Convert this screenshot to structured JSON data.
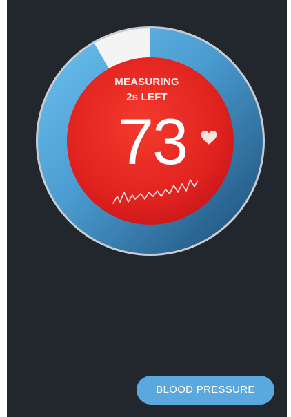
{
  "measurement": {
    "status_label": "MEASURING",
    "time_left_label": "2s LEFT",
    "heart_rate_value": "73",
    "progress_fraction": 0.917
  },
  "actions": {
    "blood_pressure_label": "BLOOD PRESSURE"
  },
  "icons": {
    "heart": "heart-icon",
    "pulse_wave": "pulse-wave-icon"
  },
  "colors": {
    "background": "#22272d",
    "progress_light": "#6fc3ee",
    "progress_dark": "#1c4f78",
    "remaining_track": "#f4f4f4",
    "center_red": "#e52722",
    "button": "#5aa8de"
  }
}
